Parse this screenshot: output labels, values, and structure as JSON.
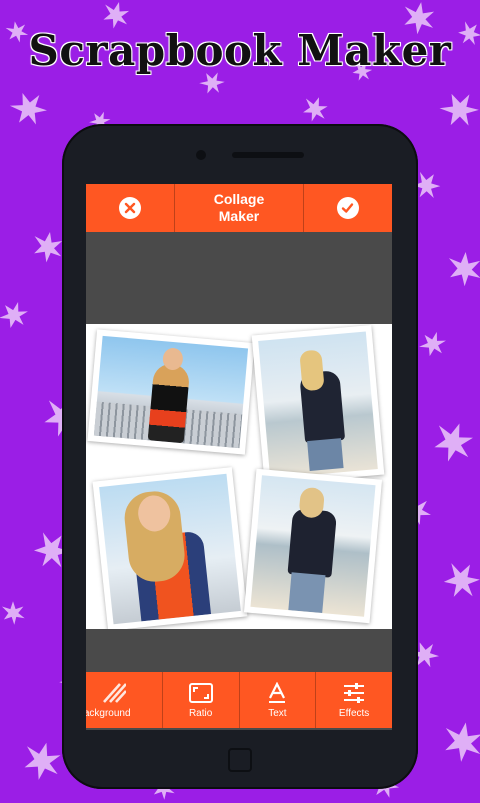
{
  "app_title": "Scrapbook Maker",
  "toolbar": {
    "cancel_icon": "close-icon",
    "title_line1": "Collage",
    "title_line2": "Maker",
    "confirm_icon": "check-icon"
  },
  "tools": [
    {
      "label": "Background",
      "icon": "background-stripes-icon"
    },
    {
      "label": "Ratio",
      "icon": "aspect-ratio-icon"
    },
    {
      "label": "Text",
      "icon": "text-icon"
    },
    {
      "label": "Effects",
      "icon": "sliders-icon"
    }
  ],
  "colors": {
    "background": "#9b1ee6",
    "accent": "#ff5722",
    "leaf": "#e7bff8"
  }
}
